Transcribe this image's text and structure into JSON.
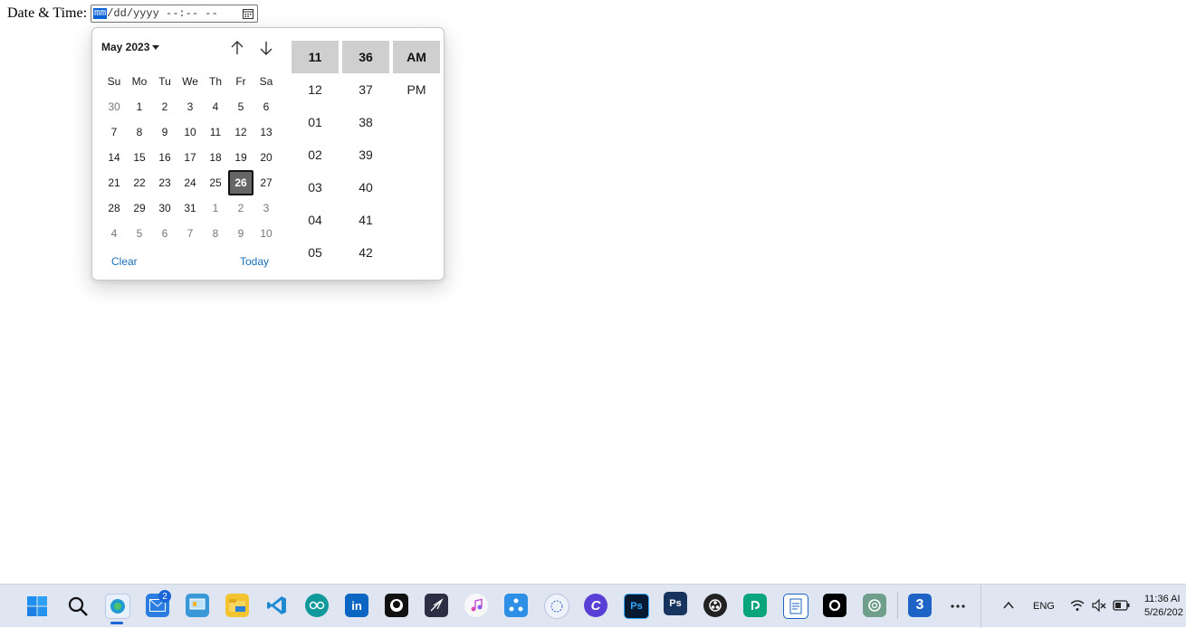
{
  "field": {
    "label": "Date & Time:",
    "seg_month": "mm",
    "seg_rest": "/dd/yyyy --:-- --"
  },
  "picker": {
    "month_label": "May 2023",
    "weekdays": [
      "Su",
      "Mo",
      "Tu",
      "We",
      "Th",
      "Fr",
      "Sa"
    ],
    "weeks": [
      [
        "30",
        "1",
        "2",
        "3",
        "4",
        "5",
        "6"
      ],
      [
        "7",
        "8",
        "9",
        "10",
        "11",
        "12",
        "13"
      ],
      [
        "14",
        "15",
        "16",
        "17",
        "18",
        "19",
        "20"
      ],
      [
        "21",
        "22",
        "23",
        "24",
        "25",
        "26",
        "27"
      ],
      [
        "28",
        "29",
        "30",
        "31",
        "1",
        "2",
        "3"
      ],
      [
        "4",
        "5",
        "6",
        "7",
        "8",
        "9",
        "10"
      ]
    ],
    "selected_day": "26",
    "clear_label": "Clear",
    "today_label": "Today",
    "hours": [
      "11",
      "12",
      "01",
      "02",
      "03",
      "04",
      "05"
    ],
    "minutes": [
      "36",
      "37",
      "38",
      "39",
      "40",
      "41",
      "42"
    ],
    "ampm": [
      "AM",
      "PM"
    ]
  },
  "taskbar": {
    "mail_badge": "2",
    "photoshop_label_1": "Ps",
    "photoshop_label_2": "Ps",
    "language": "ENG",
    "time": "11:36 AI",
    "date": "5/26/202"
  }
}
